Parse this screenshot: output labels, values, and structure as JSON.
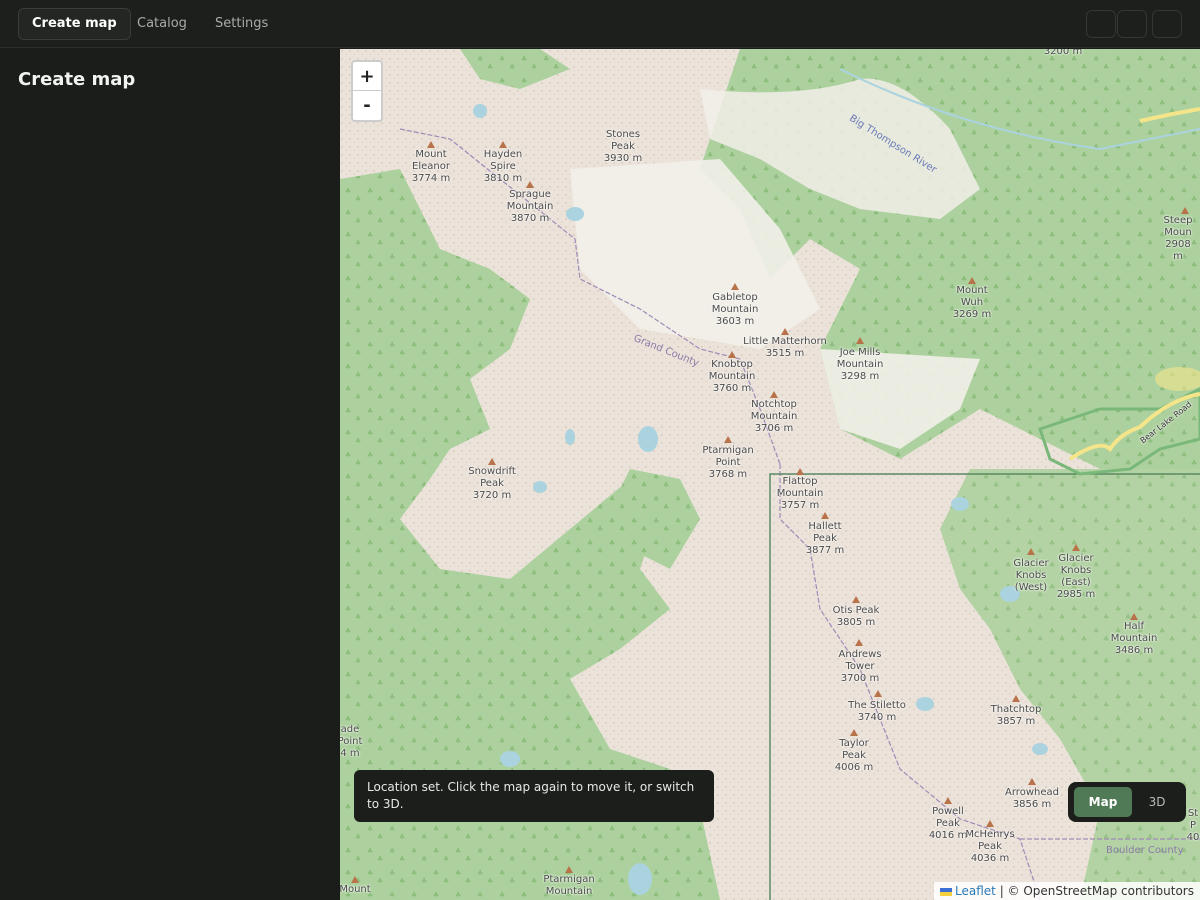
{
  "topbar": {
    "tabs": [
      {
        "label": "Create map",
        "active": true
      },
      {
        "label": "Catalog",
        "active": false
      },
      {
        "label": "Settings",
        "active": false
      }
    ]
  },
  "sidebar": {
    "title": "Create map"
  },
  "map": {
    "zoom_in": "+",
    "zoom_out": "-",
    "peaks": [
      {
        "label": "3200 m"
      },
      {
        "label": "Mount\nEleanor\n3774 m"
      },
      {
        "label": "Hayden\nSpire\n3810 m"
      },
      {
        "label": "Sprague\nMountain\n3870 m"
      },
      {
        "label": "Stones\nPeak\n3930 m"
      },
      {
        "label": "Gabletop\nMountain\n3603 m"
      },
      {
        "label": "Little Matterhorn\n3515 m"
      },
      {
        "label": "Knobtop\nMountain\n3760 m"
      },
      {
        "label": "Joe Mills\nMountain\n3298 m"
      },
      {
        "label": "Notchtop\nMountain\n3706 m"
      },
      {
        "label": "Ptarmigan\nPoint\n3768 m"
      },
      {
        "label": "Mount\nWuh\n3269 m"
      },
      {
        "label": "Steep Moun\n2908 m"
      },
      {
        "label": "Snowdrift\nPeak\n3720 m"
      },
      {
        "label": "Flattop\nMountain\n3757 m"
      },
      {
        "label": "Hallett\nPeak\n3877 m"
      },
      {
        "label": "Glacier\nKnobs\n(West)"
      },
      {
        "label": "Glacier\nKnobs\n(East)\n2985 m"
      },
      {
        "label": "Otis Peak\n3805 m"
      },
      {
        "label": "Half Mountain\n3486 m"
      },
      {
        "label": "Andrews\nTower\n3700 m"
      },
      {
        "label": "The Stiletto\n3740 m"
      },
      {
        "label": "Thatchtop\n3857 m"
      },
      {
        "label": "Taylor\nPeak\n4006 m"
      },
      {
        "label": "Arrowhead\n3856 m"
      },
      {
        "label": "Powell\nPeak\n4016 m"
      },
      {
        "label": "McHenrys\nPeak\n4036 m"
      },
      {
        "label": "ade\nPoint\n4 m"
      },
      {
        "label": "Ptarmigan\nMountain"
      },
      {
        "label": "Mount"
      },
      {
        "label": "St\nP\n40"
      }
    ],
    "river_label": "Big Thompson River",
    "county_label_grand": "Grand County",
    "county_label_boulder": "Boulder County",
    "road_label": "Bear Lake Road"
  },
  "toast": {
    "message": "Location set. Click the map again to move it, or switch to 3D."
  },
  "view_toggle": {
    "map_label": "Map",
    "d3_label": "3D",
    "selected": "Map"
  },
  "attribution": {
    "leaflet": "Leaflet",
    "separator": " | ",
    "osm": "© OpenStreetMap contributors"
  },
  "colors": {
    "accent": "#4f7a55",
    "forest": "#add19e",
    "water": "#aad3df",
    "land": "#efebe3"
  }
}
